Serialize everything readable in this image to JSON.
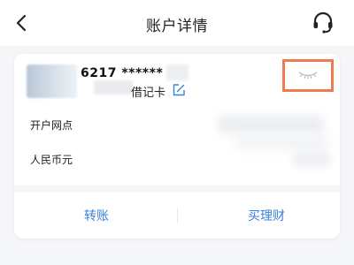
{
  "header": {
    "title": "账户详情",
    "back_icon": "chevron-left-icon",
    "support_icon": "headset-icon"
  },
  "account": {
    "card_number": "6217 ******",
    "card_type": "借记卡",
    "edit_icon": "edit-icon",
    "visibility_icon": "eye-closed-icon",
    "highlight_color": "#ef7a4e",
    "rows": [
      {
        "label": "开户网点"
      },
      {
        "label": "人民币元"
      }
    ]
  },
  "actions": {
    "transfer_label": "转账",
    "buy_wealth_label": "买理财",
    "link_color": "#3b82d8"
  }
}
